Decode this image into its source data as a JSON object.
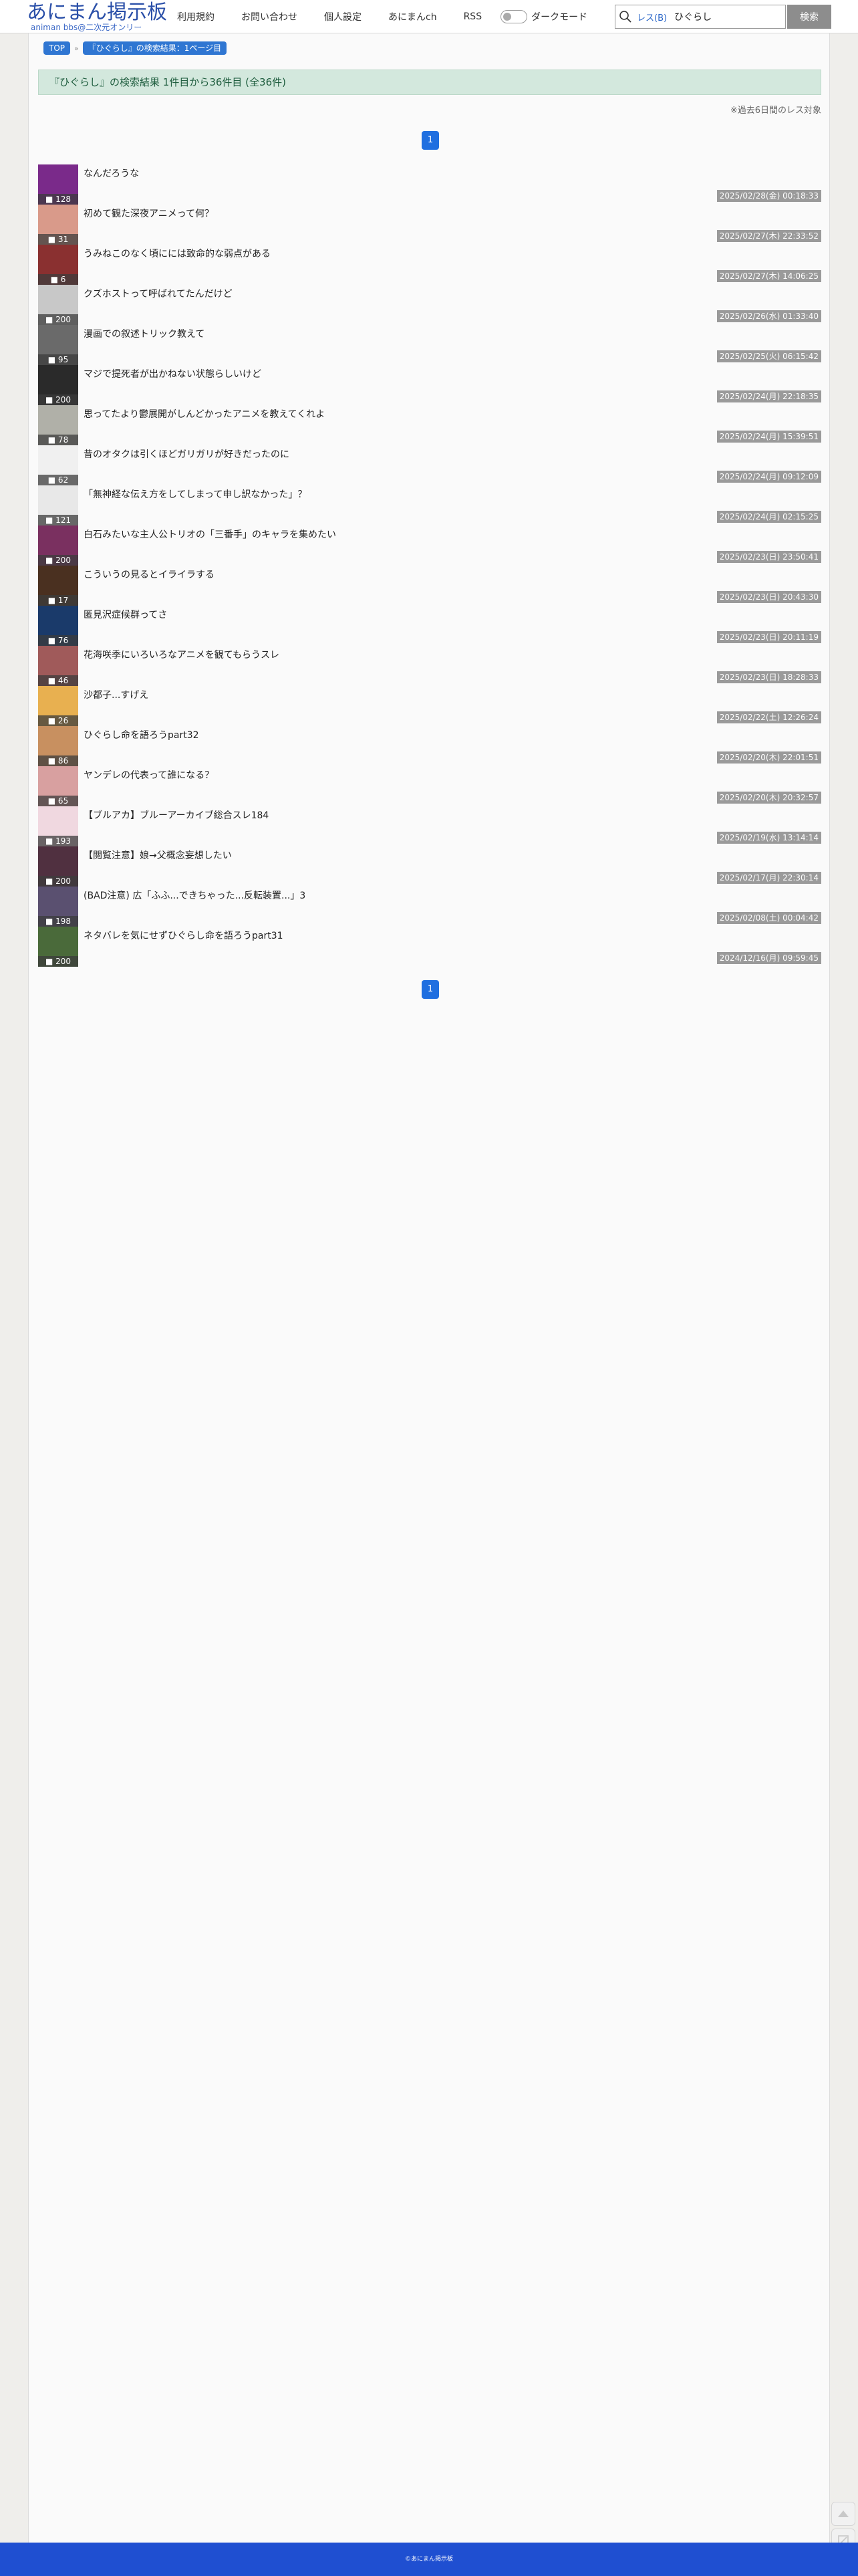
{
  "header": {
    "logo_main": "あにまん掲示板",
    "logo_sub": "animan bbs@二次元オンリー",
    "nav": [
      "利用規約",
      "お問い合わせ",
      "個人設定",
      "あにまんch",
      "RSS"
    ],
    "dark_mode_label": "ダークモード",
    "search_type": "レス(B)",
    "search_value": "ひぐらし",
    "search_button": "検索"
  },
  "breadcrumb": {
    "top": "TOP",
    "current": "『ひぐらし』の検索結果：1ページ目"
  },
  "result_header": "『ひぐらし』の検索結果 1件目から36件目 (全36件)",
  "note": "※過去6日間のレス対象",
  "pager": {
    "current_page": "1"
  },
  "threads": [
    {
      "title": "なんだろうな",
      "count": "128",
      "date": "2025/02/28(金) 00:18:33",
      "color": "#7a2a8a"
    },
    {
      "title": "初めて観た深夜アニメって何？",
      "count": "31",
      "date": "2025/02/27(木) 22:33:52",
      "color": "#d99a8a"
    },
    {
      "title": "うみねこのなく頃にには致命的な弱点がある",
      "count": "6",
      "date": "2025/02/27(木) 14:06:25",
      "color": "#8a3030"
    },
    {
      "title": "クズホストって呼ばれてたんだけど",
      "count": "200",
      "date": "2025/02/26(水) 01:33:40",
      "color": "#c8c8c8"
    },
    {
      "title": "漫画での叙述トリック教えて",
      "count": "95",
      "date": "2025/02/25(火) 06:15:42",
      "color": "#6a6a6a"
    },
    {
      "title": "マジで提死者が出かねない状態らしいけど",
      "count": "200",
      "date": "2025/02/24(月) 22:18:35",
      "color": "#2a2a2a"
    },
    {
      "title": "思ってたより鬱展開がしんどかったアニメを教えてくれよ",
      "count": "78",
      "date": "2025/02/24(月) 15:39:51",
      "color": "#b0b0a8"
    },
    {
      "title": "昔のオタクは引くほどガリガリが好きだったのに",
      "count": "62",
      "date": "2025/02/24(月) 09:12:09",
      "color": "#f0f0f0"
    },
    {
      "title": "「無神経な伝え方をしてしまって申し訳なかった」？",
      "count": "121",
      "date": "2025/02/24(月) 02:15:25",
      "color": "#e8e8e8"
    },
    {
      "title": "白石みたいな主人公トリオの「三番手」のキャラを集めたい",
      "count": "200",
      "date": "2025/02/23(日) 23:50:41",
      "color": "#7a3060"
    },
    {
      "title": "こういうの見るとイライラする",
      "count": "17",
      "date": "2025/02/23(日) 20:43:30",
      "color": "#4a3020"
    },
    {
      "title": "匿見沢症候群ってさ",
      "count": "76",
      "date": "2025/02/23(日) 20:11:19",
      "color": "#1a3a6a"
    },
    {
      "title": "花海咲季にいろいろなアニメを観てもらうスレ",
      "count": "46",
      "date": "2025/02/23(日) 18:28:33",
      "color": "#a05a5a"
    },
    {
      "title": "沙都子...すげえ",
      "count": "26",
      "date": "2025/02/22(土) 12:26:24",
      "color": "#e8b050"
    },
    {
      "title": "ひぐらし命を語ろうpart32",
      "count": "86",
      "date": "2025/02/20(木) 22:01:51",
      "color": "#c89060"
    },
    {
      "title": "ヤンデレの代表って誰になる？",
      "count": "65",
      "date": "2025/02/20(木) 20:32:57",
      "color": "#d8a0a0"
    },
    {
      "title": "【ブルアカ】ブルーアーカイブ総合スレ184",
      "count": "193",
      "date": "2025/02/19(水) 13:14:14",
      "color": "#f0d8e0"
    },
    {
      "title": "【閲覧注意】娘→父概念妄想したい",
      "count": "200",
      "date": "2025/02/17(月) 22:30:14",
      "color": "#503040"
    },
    {
      "title": "(BAD注意) 広「ふふ...できちゃった...反転装置...」3",
      "count": "198",
      "date": "2025/02/08(土) 00:04:42",
      "color": "#5a5070"
    },
    {
      "title": "ネタバレを気にせずひぐらし命を語ろうpart31",
      "count": "200",
      "date": "2024/12/16(月) 09:59:45",
      "color": "#4a6a3a"
    }
  ],
  "footer": "©あにまん掲示板",
  "colors": {
    "accent": "#2f76d2",
    "footer": "#1f4fd1",
    "header_band": "#d3e8dd"
  }
}
